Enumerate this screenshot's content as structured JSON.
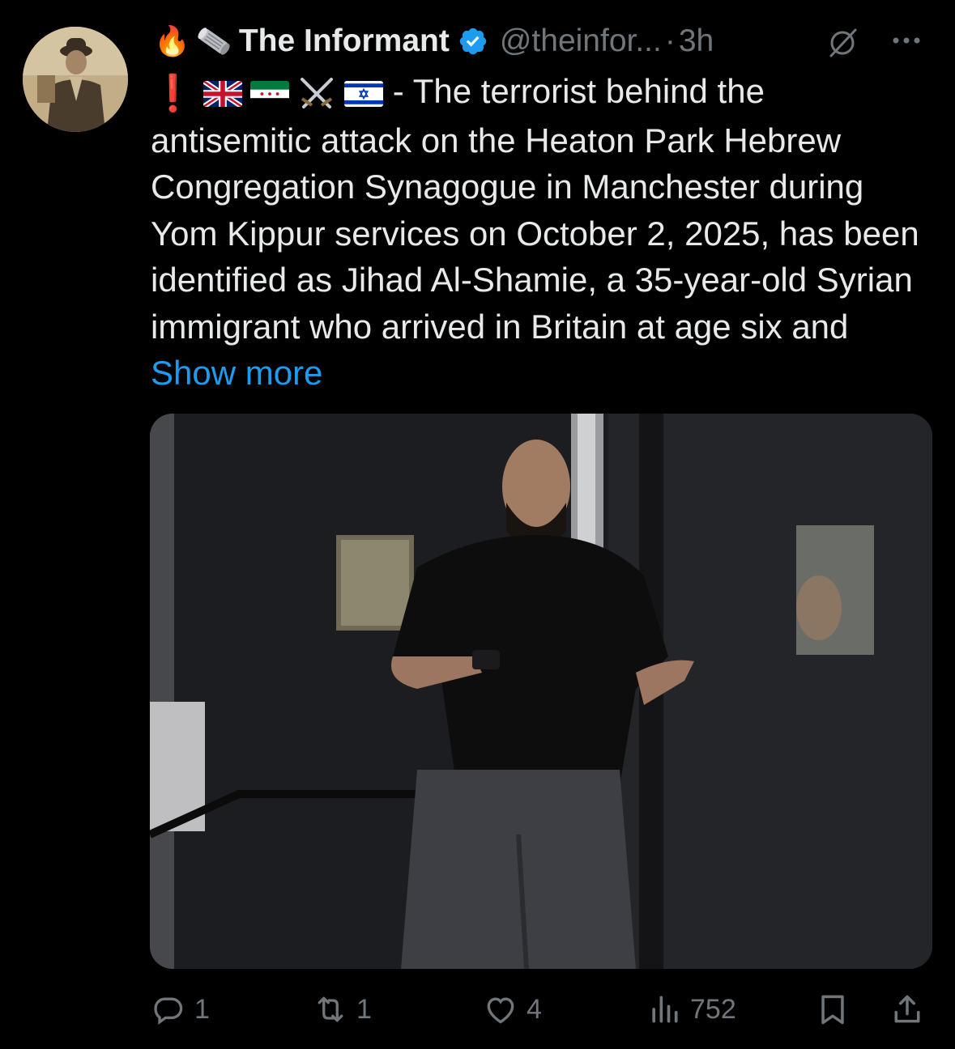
{
  "author": {
    "name_emoji": "🔥",
    "display_name": "The Informant",
    "handle": "@theinfor...",
    "separator": "·",
    "time": "3h"
  },
  "tweet": {
    "emoji_prefix": "❗",
    "text": "- The terrorist behind the antisemitic attack on the Heaton Park Hebrew Congregation Synagogue in Manchester during Yom Kippur services on October 2, 2025, has been identified as Jihad Al-Shamie, a 35-year-old Syrian immigrant who arrived in Britain at age six and ",
    "show_more": "Show more"
  },
  "stats": {
    "replies": "1",
    "reposts": "1",
    "likes": "4",
    "views": "752"
  },
  "colors": {
    "background": "#000000",
    "text": "#e7e9ea",
    "muted": "#71767b",
    "link": "#1d9bf0",
    "verified": "#1d9bf0"
  },
  "icons": [
    "fire-emoji",
    "scroll-icon",
    "verified-badge-icon",
    "grok-icon",
    "more-icon",
    "uk-flag-icon",
    "syria-flag-icon",
    "crossed-swords-icon",
    "israel-flag-icon",
    "reply-icon",
    "retweet-icon",
    "like-icon",
    "views-icon",
    "bookmark-icon",
    "share-icon"
  ]
}
